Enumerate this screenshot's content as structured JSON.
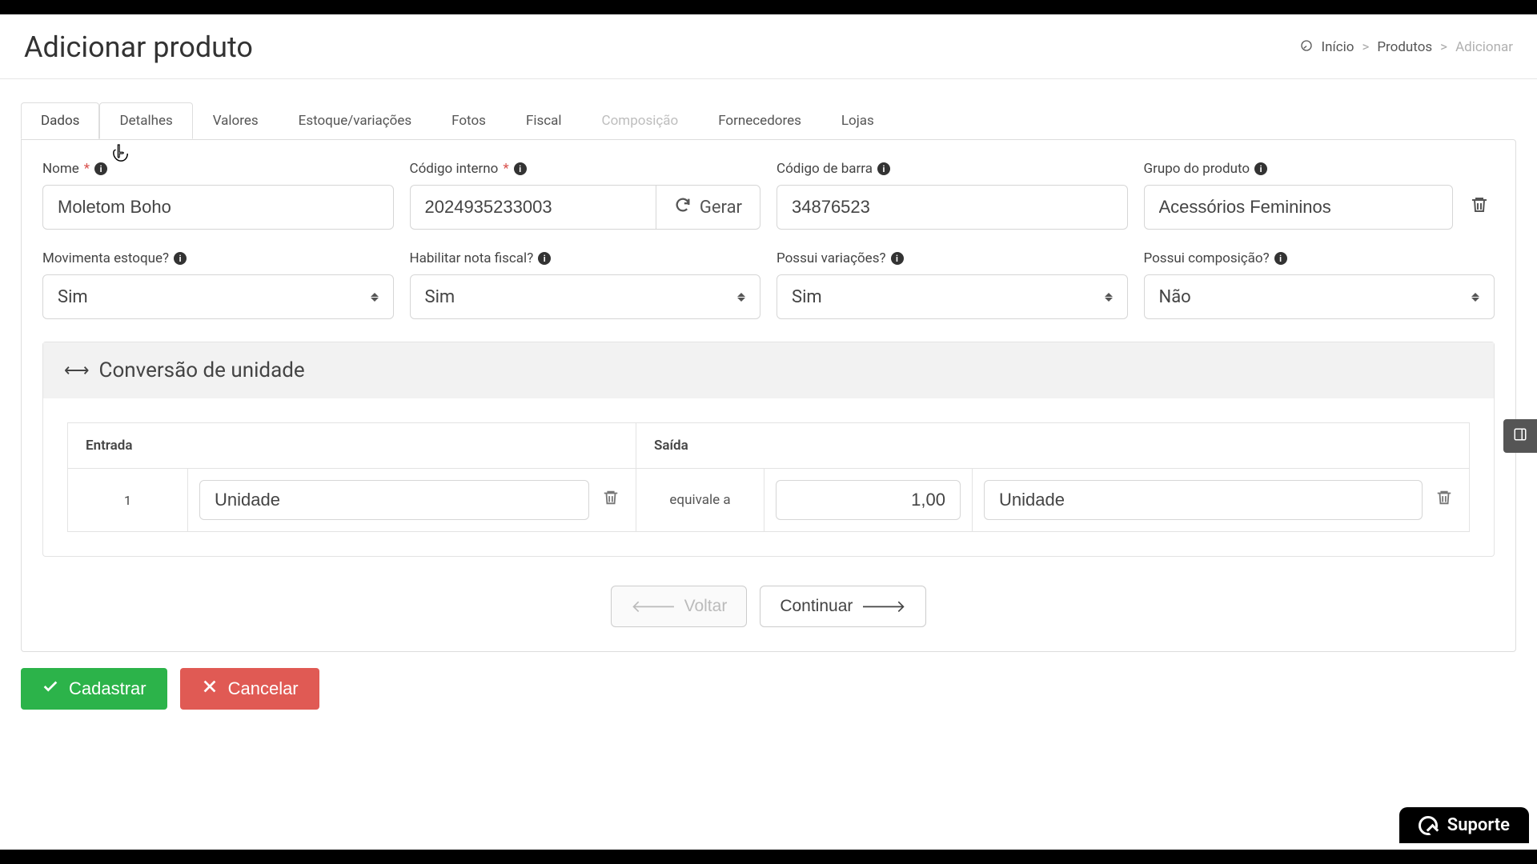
{
  "header": {
    "title": "Adicionar produto"
  },
  "breadcrumb": {
    "home": "Início",
    "products": "Produtos",
    "add": "Adicionar"
  },
  "tabs": [
    {
      "key": "dados",
      "label": "Dados",
      "state": "active"
    },
    {
      "key": "detalhes",
      "label": "Detalhes",
      "state": "hover"
    },
    {
      "key": "valores",
      "label": "Valores",
      "state": "normal"
    },
    {
      "key": "estoque",
      "label": "Estoque/variações",
      "state": "normal"
    },
    {
      "key": "fotos",
      "label": "Fotos",
      "state": "normal"
    },
    {
      "key": "fiscal",
      "label": "Fiscal",
      "state": "normal"
    },
    {
      "key": "composicao",
      "label": "Composição",
      "state": "disabled"
    },
    {
      "key": "fornecedores",
      "label": "Fornecedores",
      "state": "normal"
    },
    {
      "key": "lojas",
      "label": "Lojas",
      "state": "normal"
    }
  ],
  "fields": {
    "name": {
      "label": "Nome",
      "required": true,
      "value": "Moletom Boho"
    },
    "internal_code": {
      "label": "Código interno",
      "required": true,
      "value": "2024935233003",
      "button": "Gerar"
    },
    "barcode": {
      "label": "Código de barra",
      "value": "34876523"
    },
    "product_group": {
      "label": "Grupo do produto",
      "value": "Acessórios Femininos"
    },
    "moves_stock": {
      "label": "Movimenta estoque?",
      "value": "Sim"
    },
    "enable_invoice": {
      "label": "Habilitar nota fiscal?",
      "value": "Sim"
    },
    "has_variations": {
      "label": "Possui variações?",
      "value": "Sim"
    },
    "has_composition": {
      "label": "Possui composição?",
      "value": "Não"
    }
  },
  "unit_conversion": {
    "title": "Conversão de unidade",
    "columns": {
      "entry": "Entrada",
      "exit": "Saída"
    },
    "row": {
      "qty_in": "1",
      "unit_in": "Unidade",
      "equiv_label": "equivale a",
      "qty_out": "1,00",
      "unit_out": "Unidade"
    }
  },
  "nav": {
    "back": "Voltar",
    "continue": "Continuar"
  },
  "footer": {
    "submit": "Cadastrar",
    "cancel": "Cancelar"
  },
  "support": {
    "label": "Suporte"
  }
}
